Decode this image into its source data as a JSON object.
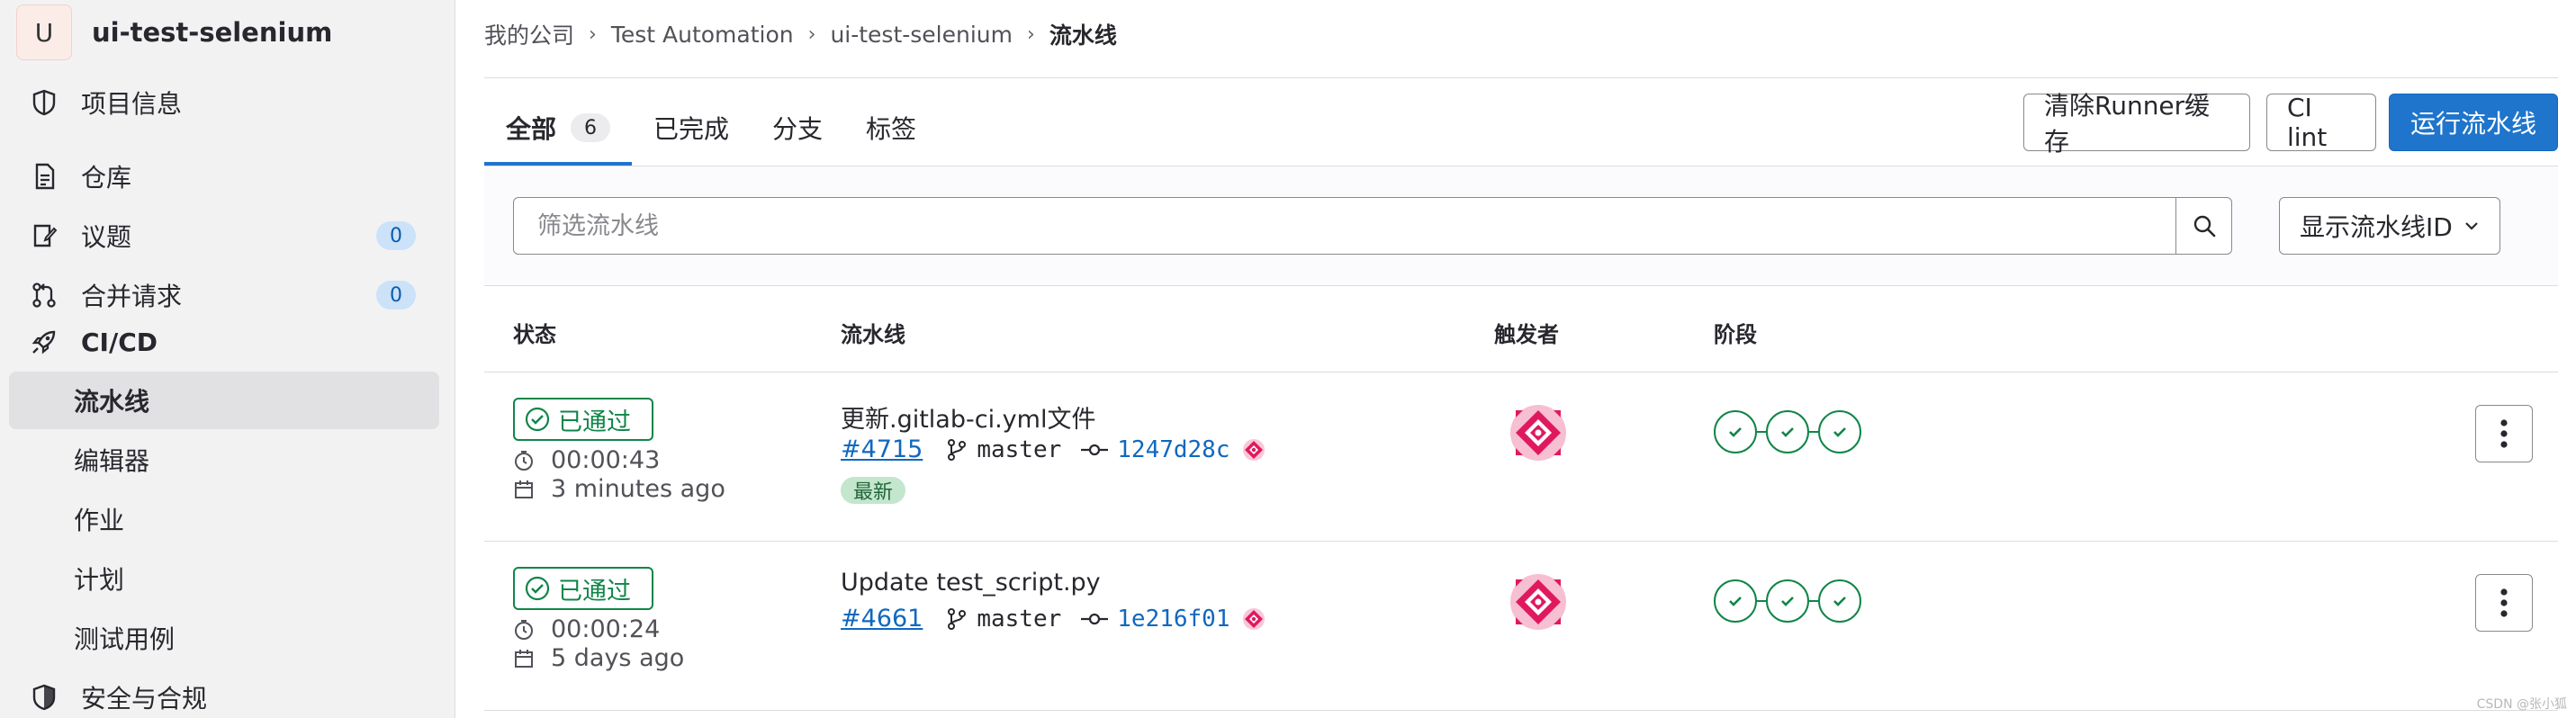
{
  "project": {
    "avatar_letter": "U",
    "name": "ui-test-selenium"
  },
  "sidebar": {
    "items": [
      {
        "label": "项目信息",
        "icon": "project-info-icon"
      },
      {
        "label": "仓库",
        "icon": "repository-icon"
      },
      {
        "label": "议题",
        "icon": "issues-icon",
        "badge": "0"
      },
      {
        "label": "合并请求",
        "icon": "merge-request-icon",
        "badge": "0"
      },
      {
        "label": "CI/CD",
        "icon": "rocket-icon"
      },
      {
        "label": "流水线",
        "active": true
      },
      {
        "label": "编辑器"
      },
      {
        "label": "作业"
      },
      {
        "label": "计划"
      },
      {
        "label": "测试用例"
      },
      {
        "label": "安全与合规",
        "icon": "shield-icon"
      }
    ]
  },
  "breadcrumb": [
    "我的公司",
    "Test Automation",
    "ui-test-selenium",
    "流水线"
  ],
  "tabs": [
    {
      "label": "全部",
      "count": "6",
      "active": true
    },
    {
      "label": "已完成"
    },
    {
      "label": "分支"
    },
    {
      "label": "标签"
    }
  ],
  "actions": {
    "clear_cache": "清除Runner缓存",
    "ci_lint": "CI lint",
    "run_pipeline": "运行流水线"
  },
  "filter": {
    "placeholder": "筛选流水线",
    "display_option": "显示流水线ID"
  },
  "table": {
    "headers": {
      "status": "状态",
      "pipeline": "流水线",
      "triggerer": "触发者",
      "stages": "阶段"
    },
    "rows": [
      {
        "status": "已通过",
        "duration": "00:00:43",
        "finished": "3 minutes ago",
        "title": "更新.gitlab-ci.yml文件",
        "id": "#4715",
        "branch": "master",
        "commit": "1247d28c",
        "latest_label": "最新",
        "stage_count": 3
      },
      {
        "status": "已通过",
        "duration": "00:00:24",
        "finished": "5 days ago",
        "title": "Update test_script.py",
        "id": "#4661",
        "branch": "master",
        "commit": "1e216f01",
        "stage_count": 3
      }
    ]
  },
  "watermark": "CSDN @张小狐",
  "colors": {
    "primary": "#1f75cb",
    "success": "#108548",
    "avatar_pink": "#e0195f"
  }
}
